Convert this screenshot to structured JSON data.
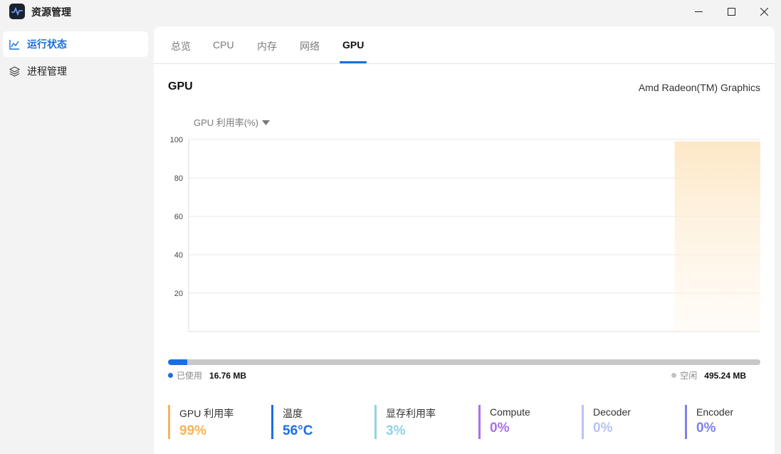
{
  "window": {
    "title": "资源管理"
  },
  "sidebar": {
    "items": [
      {
        "label": "运行状态",
        "icon": "line-chart-icon",
        "active": true
      },
      {
        "label": "进程管理",
        "icon": "layers-icon",
        "active": false
      }
    ]
  },
  "tabs": [
    {
      "label": "总览"
    },
    {
      "label": "CPU"
    },
    {
      "label": "内存"
    },
    {
      "label": "网络"
    },
    {
      "label": "GPU",
      "active": true
    }
  ],
  "gpu": {
    "heading": "GPU",
    "model": "Amd Radeon(TM) Graphics",
    "metric_selector": "GPU 利用率(%)"
  },
  "chart_data": {
    "type": "area",
    "y_ticks": [
      "100",
      "80",
      "60",
      "40",
      "20"
    ],
    "ylim": [
      0,
      100
    ],
    "grid": true,
    "x": [
      0,
      1,
      2,
      3,
      4,
      5,
      6,
      7,
      8,
      9,
      10,
      11,
      12,
      13,
      14,
      15,
      16,
      17,
      18,
      19,
      20
    ],
    "series": [
      {
        "values": [
          0,
          0,
          0,
          0,
          0,
          0,
          0,
          0,
          0,
          0,
          0,
          0,
          0,
          0,
          0,
          0,
          0,
          99,
          99,
          99,
          99
        ],
        "color": "#f5b55a"
      }
    ]
  },
  "memory": {
    "used_label": "已使用",
    "used_value": "16.76 MB",
    "free_label": "空闲",
    "free_value": "495.24 MB",
    "used_fraction": 0.0327,
    "used_color": "#1a6fe0",
    "free_color": "#c8c8c8"
  },
  "stats": [
    {
      "label": "GPU 利用率",
      "value": "99%",
      "color": "#f5b55a"
    },
    {
      "label": "温度",
      "value": "56°C",
      "color": "#1a6fe0"
    },
    {
      "label": "显存利用率",
      "value": "3%",
      "color": "#8fd3e6"
    },
    {
      "label": "Compute",
      "value": "0%",
      "color": "#a970e8"
    },
    {
      "label": "Decoder",
      "value": "0%",
      "color": "#b9c3f3"
    },
    {
      "label": "Encoder",
      "value": "0%",
      "color": "#7f7ff0"
    }
  ]
}
